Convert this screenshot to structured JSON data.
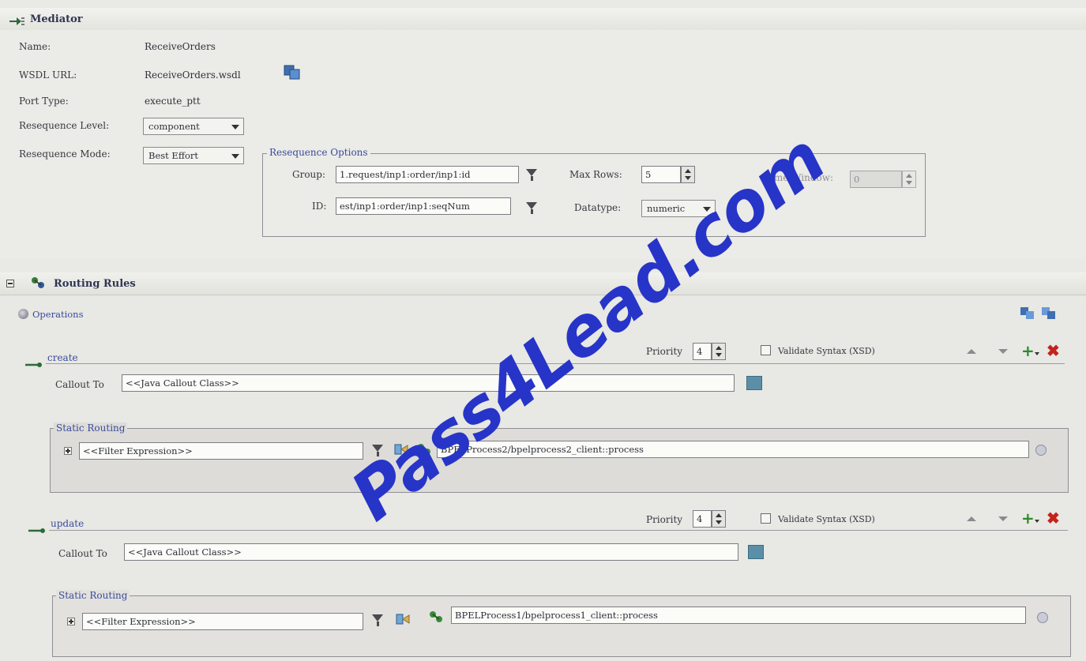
{
  "mediator": {
    "title": "Mediator",
    "name_label": "Name:",
    "name_value": "ReceiveOrders",
    "wsdl_label": "WSDL URL:",
    "wsdl_value": "ReceiveOrders.wsdl",
    "port_label": "Port Type:",
    "port_value": "execute_ptt",
    "reseq_level_label": "Resequence Level:",
    "reseq_level_value": "component",
    "reseq_mode_label": "Resequence Mode:",
    "reseq_mode_value": "Best Effort"
  },
  "reseq_options": {
    "legend": "Resequence Options",
    "group_label": "Group:",
    "group_value": "1.request/inp1:order/inp1:id",
    "id_label": "ID:",
    "id_value": "est/inp1:order/inp1:seqNum",
    "max_rows_label": "Max Rows:",
    "max_rows_value": "5",
    "datatype_label": "Datatype:",
    "datatype_value": "numeric",
    "time_window_label": "Time Window:",
    "time_window_value": "0"
  },
  "routing": {
    "title": "Routing Rules",
    "operations_label": "Operations",
    "ops": [
      {
        "name": "create",
        "priority_label": "Priority",
        "priority_value": "4",
        "validate_label": "Validate Syntax (XSD)",
        "callout_label": "Callout To",
        "callout_value": "<<Java Callout Class>>",
        "static_legend": "Static Routing",
        "filter_value": "<<Filter Expression>>",
        "target": "BPELProcess2/bpelprocess2_client::process"
      },
      {
        "name": "update",
        "priority_label": "Priority",
        "priority_value": "4",
        "validate_label": "Validate Syntax (XSD)",
        "callout_label": "Callout To",
        "callout_value": "<<Java Callout Class>>",
        "static_legend": "Static Routing",
        "filter_value": "<<Filter Expression>>",
        "target": "BPELProcess1/bpelprocess1_client::process"
      }
    ]
  },
  "watermark": "Pass4Lead.com",
  "colors": {
    "link": "#3a4a9a",
    "add": "#2d8a2a",
    "delete": "#c4231c",
    "watermark": "#2734c8"
  }
}
